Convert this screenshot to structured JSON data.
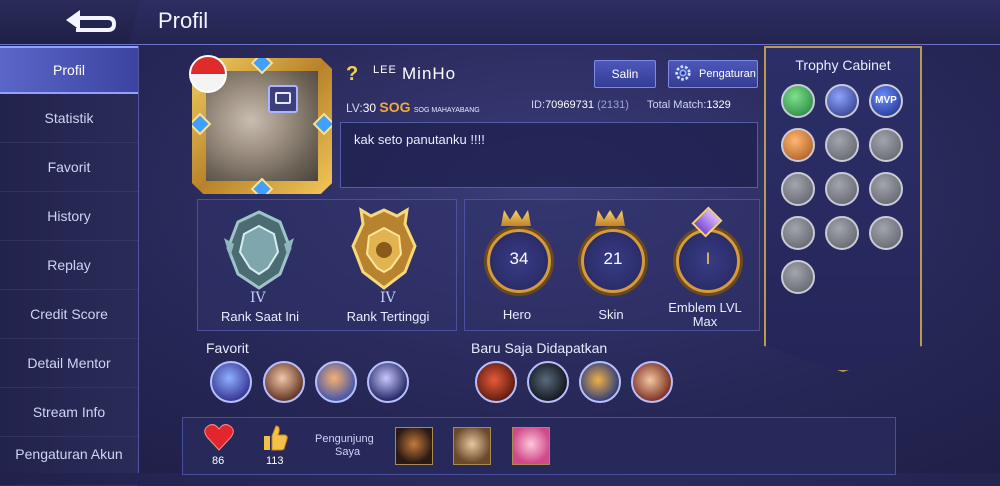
{
  "header": {
    "title": "Profil"
  },
  "sidebar": {
    "items": [
      {
        "label": "Profil",
        "active": true
      },
      {
        "label": "Statistik"
      },
      {
        "label": "Favorit"
      },
      {
        "label": "History"
      },
      {
        "label": "Replay"
      },
      {
        "label": "Credit Score"
      },
      {
        "label": "Detail Mentor"
      },
      {
        "label": "Stream Info"
      },
      {
        "label": "Pengaturan Akun"
      }
    ]
  },
  "profile": {
    "question": "?",
    "name_prefix": "LEE",
    "name_main": "MinHo",
    "copy_label": "Salin",
    "settings_label": "Pengaturan",
    "level_label": "LV:",
    "level": "30",
    "squad": "SOG",
    "squad_full": "SOG MAHAYABANG",
    "id_label": "ID:",
    "id": "70969731",
    "server": "(2131)",
    "total_match_label": "Total Match:",
    "total_match": "1329",
    "bio": "kak seto panutanku !!!!"
  },
  "ranks": [
    {
      "tier": "IV",
      "label": "Rank Saat Ini"
    },
    {
      "tier": "IV",
      "label": "Rank Tertinggi"
    }
  ],
  "stats": [
    {
      "value": "34",
      "label": "Hero"
    },
    {
      "value": "21",
      "label": "Skin"
    },
    {
      "value": "I",
      "label": "Emblem LVL Max"
    }
  ],
  "sections": {
    "favorite": "Favorit",
    "recent": "Baru Saja Didapatkan"
  },
  "trophy": {
    "title": "Trophy Cabinet",
    "mvp_label": "MVP"
  },
  "bottom": {
    "likes": "86",
    "thumbs": "113",
    "visitors_label_1": "Pengunjung",
    "visitors_label_2": "Saya"
  },
  "colors": {
    "accent": "#f4a93a",
    "gold": "#d79a3b",
    "panel": "#30326a"
  }
}
